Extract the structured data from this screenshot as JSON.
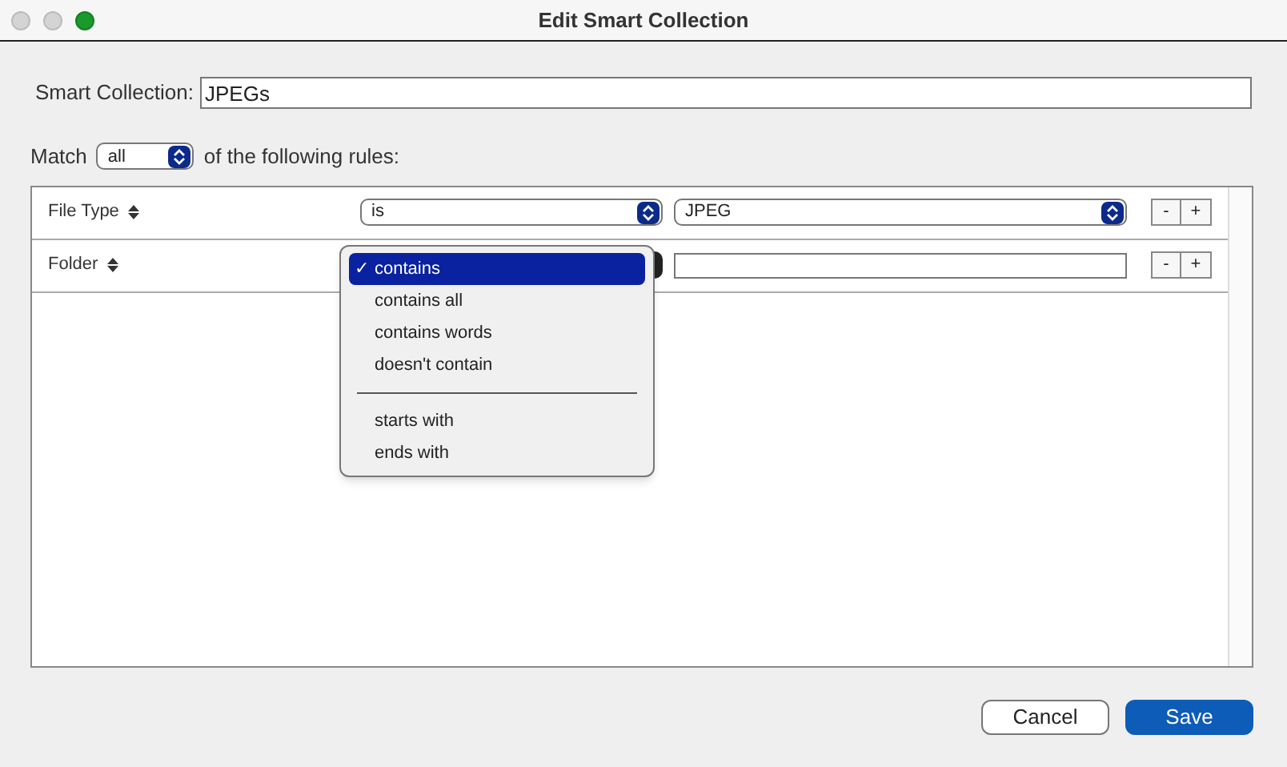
{
  "window": {
    "title": "Edit Smart Collection"
  },
  "name_field": {
    "label": "Smart Collection:",
    "value": "JPEGs"
  },
  "match": {
    "prefix": "Match",
    "value": "all",
    "suffix": "of the following rules:"
  },
  "rules": [
    {
      "field": "File Type",
      "operator": "is",
      "kind": "popup",
      "value": "JPEG",
      "remove": "-",
      "add": "+"
    },
    {
      "field": "Folder",
      "kind": "text",
      "remove": "-",
      "add": "+"
    }
  ],
  "menu": [
    {
      "kind": "item",
      "label": "contains",
      "selected": true,
      "check": "✓"
    },
    {
      "kind": "item",
      "label": "contains all",
      "selected": false
    },
    {
      "kind": "item",
      "label": "contains words",
      "selected": false
    },
    {
      "kind": "item",
      "label": "doesn't contain",
      "selected": false
    },
    {
      "kind": "separator"
    },
    {
      "kind": "item",
      "label": "starts with",
      "selected": false
    },
    {
      "kind": "item",
      "label": "ends with",
      "selected": false
    }
  ],
  "buttons": [
    {
      "label": "Cancel",
      "kind": "secondary"
    },
    {
      "label": "Save",
      "kind": "primary"
    }
  ]
}
